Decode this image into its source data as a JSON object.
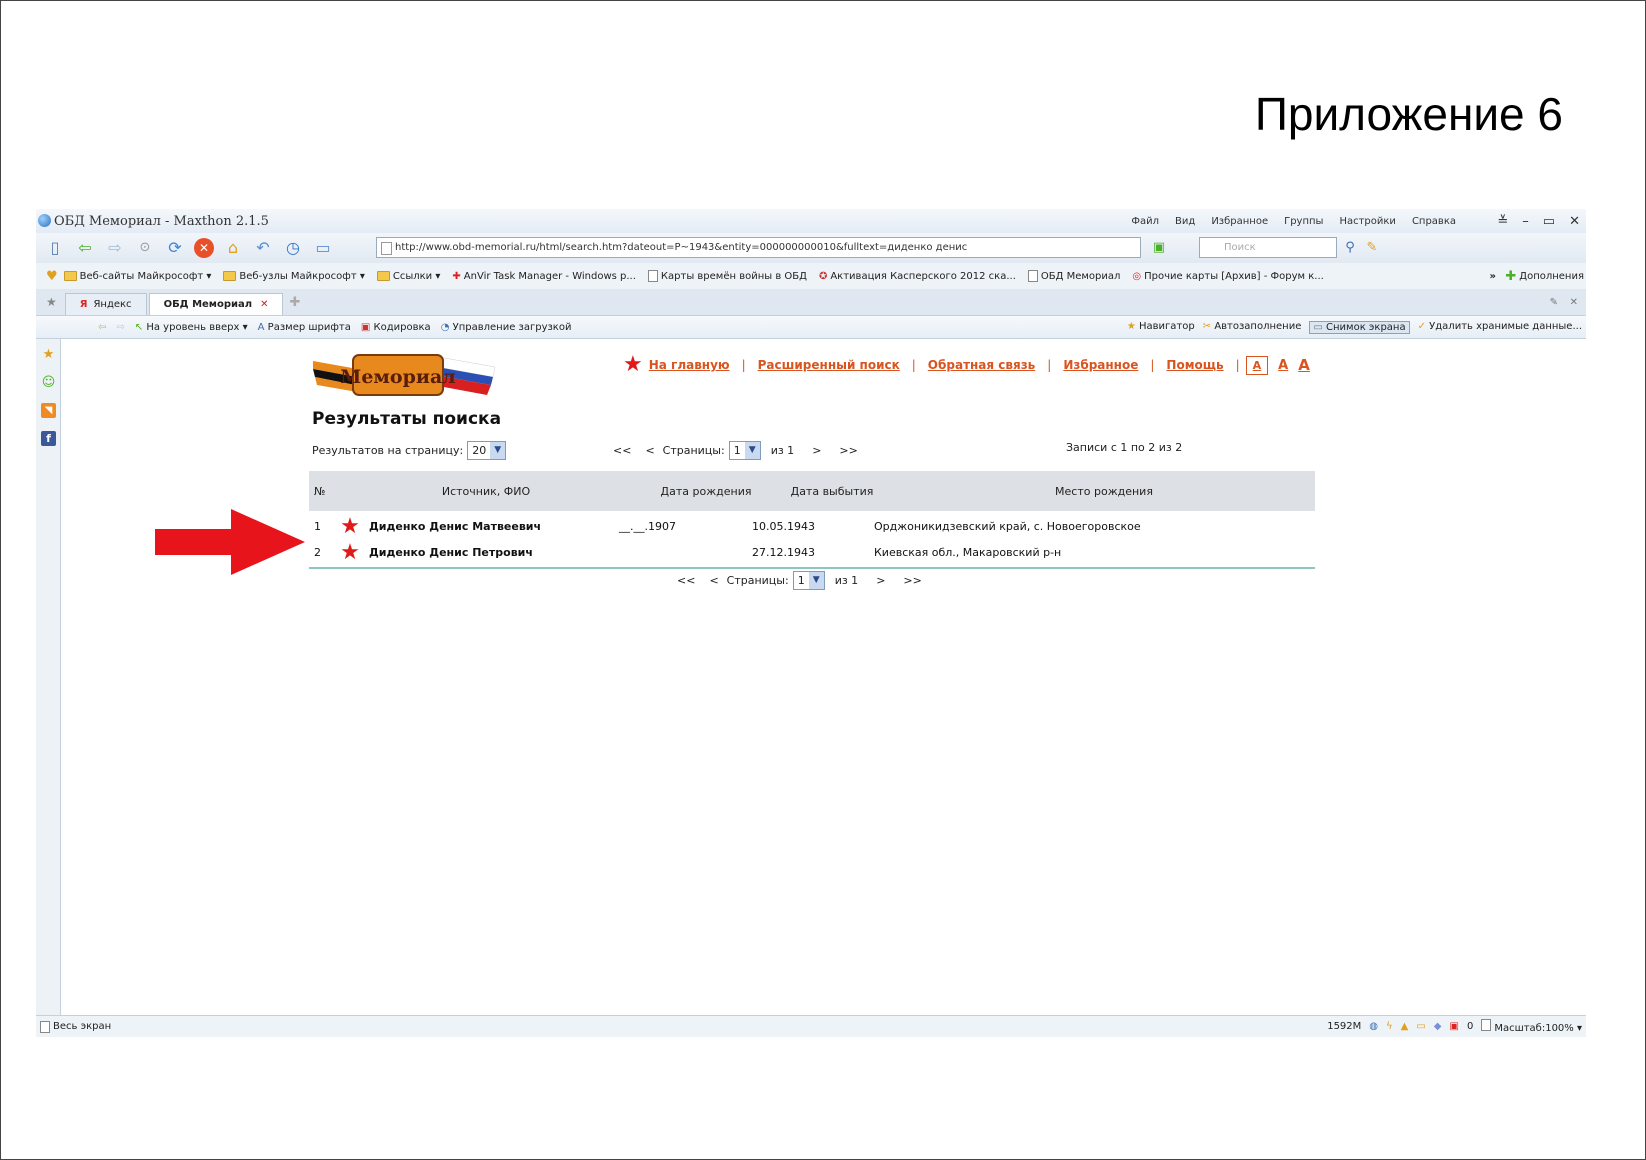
{
  "slide": {
    "title": "Приложение 6"
  },
  "window": {
    "title": "ОБД Мемориал - Maxthon 2.1.5",
    "menu": [
      "Файл",
      "Вид",
      "Избранное",
      "Группы",
      "Настройки",
      "Справка"
    ],
    "controls": [
      "≚",
      "–",
      "▭",
      "✕"
    ]
  },
  "toolbar": {
    "address": "http://www.obd-memorial.ru/html/search.htm?dateout=P~1943&entity=000000000010&fulltext=диденко денис",
    "search_placeholder": "Поиск"
  },
  "favorites": [
    "Веб-сайты Майкрософт ▾",
    "Веб-узлы Майкрософт ▾",
    "Ссылки ▾",
    "AnVir Task Manager - Windows p...",
    "Карты времён войны в ОБД",
    "Активация Касперского 2012 ска...",
    "ОБД Мемориал",
    "Прочие карты [Архив] - Форум к..."
  ],
  "favorites_extra": "Дополнения",
  "tabs": [
    {
      "label": "Яндекс"
    },
    {
      "label": "ОБД Мемориал",
      "close": "✕"
    }
  ],
  "navbar": {
    "left": [
      "На уровень вверх ▾",
      "Размер шрифта",
      "Кодировка",
      "Управление загрузкой"
    ],
    "right": [
      "Навигатор",
      "Автозаполнение",
      "Снимок экрана",
      "Удалить хранимые данные..."
    ]
  },
  "site": {
    "logo_text": "Мемориал",
    "nav": [
      "На главную",
      "Расширенный поиск",
      "Обратная связь",
      "Избранное",
      "Помощь"
    ],
    "font_sizes": [
      "A",
      "A",
      "A"
    ],
    "heading": "Результаты поиска",
    "per_page_label": "Результатов на страницу:",
    "per_page_value": "20",
    "pager": {
      "first": "<<",
      "prev": "<",
      "label": "Страницы:",
      "value": "1",
      "of": "из 1",
      "next": ">",
      "last": ">>"
    },
    "records": "Записи с 1 по 2 из 2",
    "columns": [
      "№",
      "Источник, ФИО",
      "Дата рождения",
      "Дата выбытия",
      "Место рождения"
    ],
    "rows": [
      {
        "no": "1",
        "name": "Диденко Денис Матвеевич",
        "birth": "__.__.1907",
        "death": "10.05.1943",
        "place": "Орджоникидзевский край, с. Новоегоровское"
      },
      {
        "no": "2",
        "name": "Диденко Денис Петрович",
        "birth": "",
        "death": "27.12.1943",
        "place": "Киевская обл., Макаровский р-н"
      }
    ]
  },
  "status": {
    "left": "Весь экран",
    "memory": "1592M",
    "count": "0",
    "zoom": "Масштаб:100% ▾"
  },
  "colors": {
    "accent": "#d9541e",
    "star": "#e01a1a",
    "arrow": "#e8141b",
    "table_header": "#dde1e5"
  }
}
